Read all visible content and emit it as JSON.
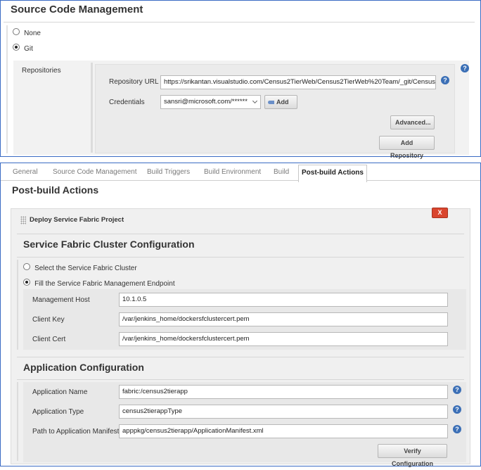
{
  "scm": {
    "title": "Source Code Management",
    "options": [
      {
        "label": "None",
        "selected": false
      },
      {
        "label": "Git",
        "selected": true
      }
    ],
    "repositories_label": "Repositories",
    "repository_url_label": "Repository URL",
    "repository_url_value": "https://srikantan.visualstudio.com/Census2TierWeb/Census2TierWeb%20Team/_git/Census",
    "credentials_label": "Credentials",
    "credentials_value": "sansri@microsoft.com/******",
    "add_button": "Add",
    "advanced_button": "Advanced...",
    "add_repository_button": "Add Repository",
    "help_glyph": "?"
  },
  "tabs": [
    {
      "label": "General",
      "active": false
    },
    {
      "label": "Source Code Management",
      "active": false
    },
    {
      "label": "Build Triggers",
      "active": false
    },
    {
      "label": "Build Environment",
      "active": false
    },
    {
      "label": "Build",
      "active": false
    },
    {
      "label": "Post-build Actions",
      "active": true
    }
  ],
  "post_build": {
    "title": "Post-build Actions",
    "step_title": "Deploy Service Fabric Project",
    "close_label": "X",
    "cluster_section": {
      "title": "Service Fabric Cluster Configuration",
      "options": [
        {
          "label": "Select the Service Fabric Cluster",
          "selected": false
        },
        {
          "label": "Fill the Service Fabric Management Endpoint",
          "selected": true
        }
      ],
      "fields": [
        {
          "label": "Management Host",
          "value": "10.1.0.5"
        },
        {
          "label": "Client Key",
          "value": "/var/jenkins_home/dockersfclustercert.pem"
        },
        {
          "label": "Client Cert",
          "value": "/var/jenkins_home/dockersfclustercert.pem"
        }
      ]
    },
    "app_section": {
      "title": "Application Configuration",
      "fields": [
        {
          "label": "Application Name",
          "value": "fabric:/census2tierapp"
        },
        {
          "label": "Application Type",
          "value": "census2tierappType"
        },
        {
          "label": "Path to Application Manifest",
          "value": "apppkg/census2tierapp/ApplicationManifest.xml"
        }
      ],
      "verify_button": "Verify Configuration"
    }
  },
  "colors": {
    "panel_border": "#3a6bc4",
    "help_icon": "#3b6fb6",
    "close_button": "#d9452e"
  }
}
